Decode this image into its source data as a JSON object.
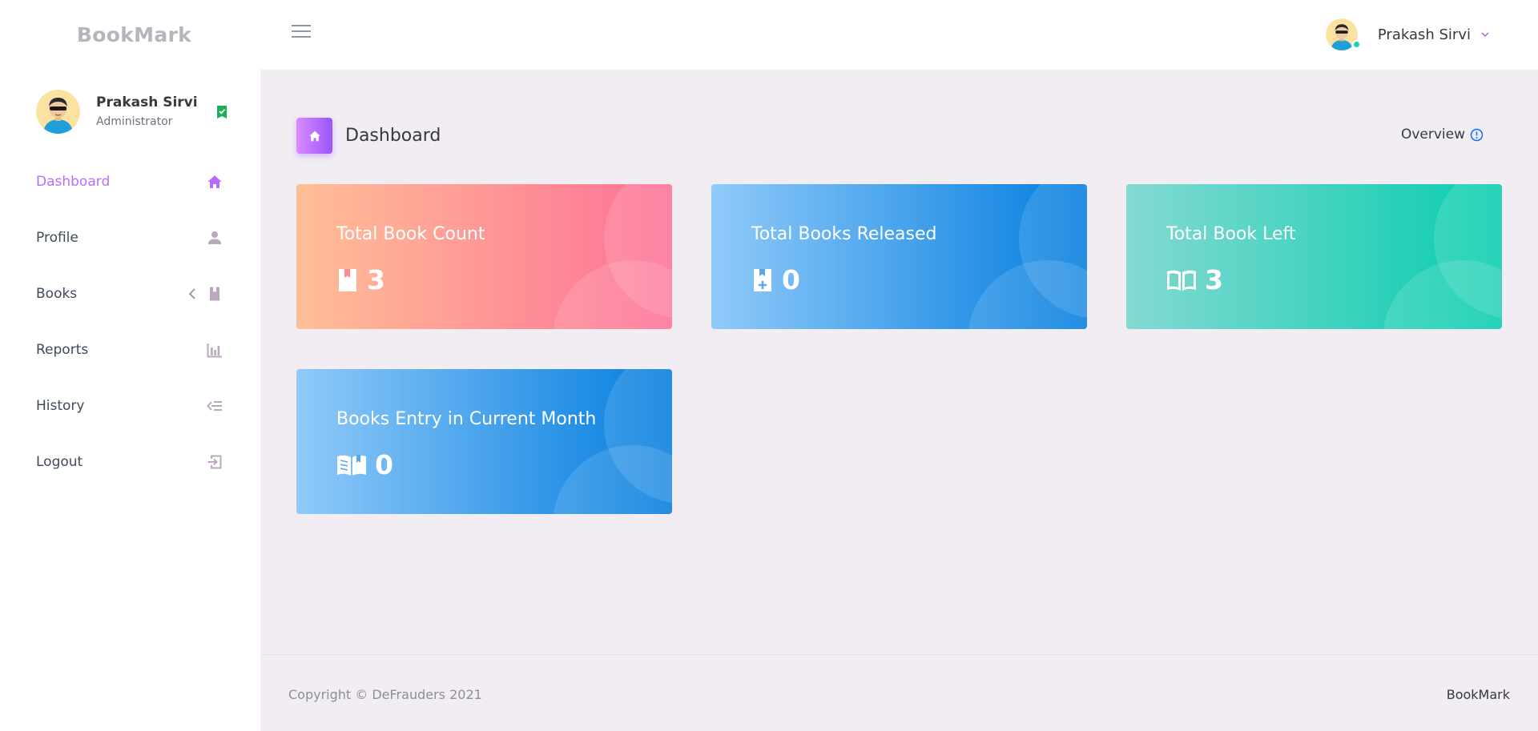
{
  "app": {
    "brand": "BookMark"
  },
  "user": {
    "name": "Prakash Sirvi",
    "role": "Administrator"
  },
  "sidebar": {
    "items": [
      {
        "label": "Dashboard",
        "icon": "home-icon",
        "active": true
      },
      {
        "label": "Profile",
        "icon": "user-icon"
      },
      {
        "label": "Books",
        "icon": "book-icon",
        "expandable": true
      },
      {
        "label": "Reports",
        "icon": "bar-chart-icon"
      },
      {
        "label": "History",
        "icon": "history-icon"
      },
      {
        "label": "Logout",
        "icon": "logout-icon"
      }
    ]
  },
  "page": {
    "title": "Dashboard",
    "overview_label": "Overview"
  },
  "cards": [
    {
      "title": "Total Book Count",
      "value": "3",
      "icon": "book-icon",
      "color": "#fe7096"
    },
    {
      "title": "Total Books Released",
      "value": "0",
      "icon": "book-plus-icon",
      "color": "#047edf"
    },
    {
      "title": "Total Book Left",
      "value": "3",
      "icon": "open-book-icon",
      "color": "#07cdae"
    },
    {
      "title": "Books Entry in Current Month",
      "value": "0",
      "icon": "open-book-variant-icon",
      "color": "#047edf"
    }
  ],
  "footer": {
    "copyright": "Copyright © DeFrauders 2021",
    "brand": "BookMark"
  },
  "colors": {
    "accent": "#b66dff",
    "online": "#1bcfb4"
  }
}
